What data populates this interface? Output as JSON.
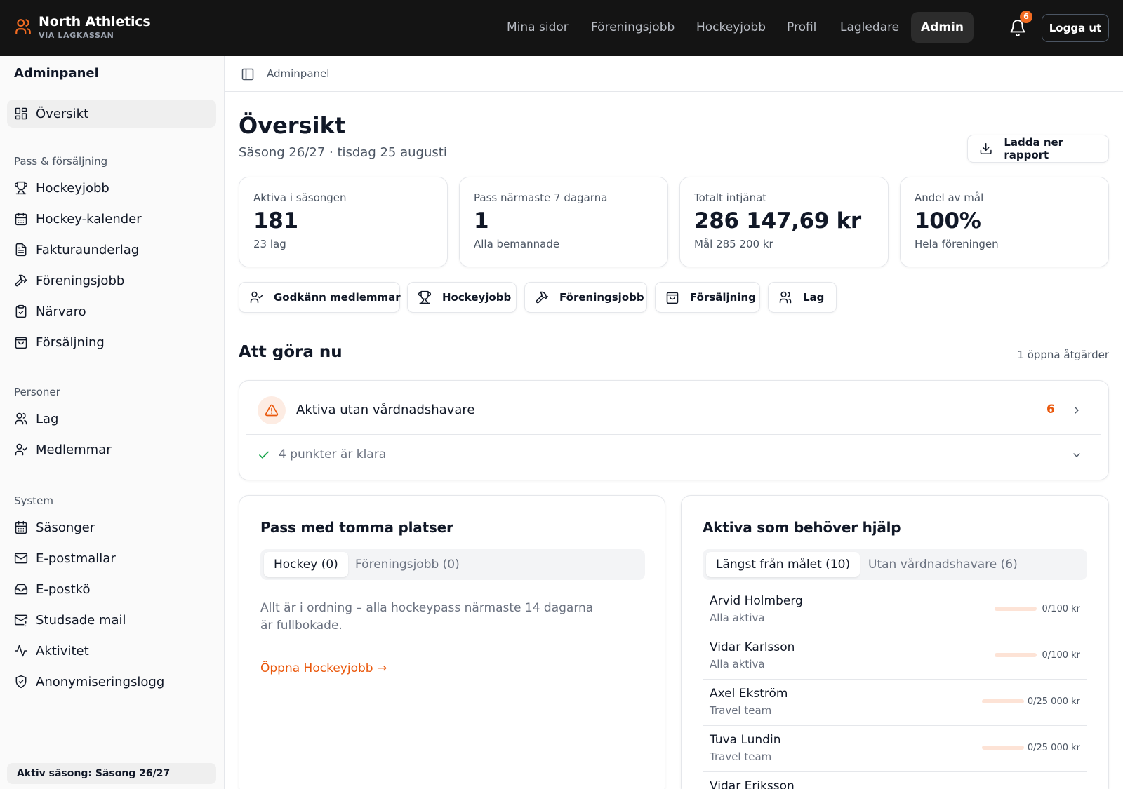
{
  "brand": {
    "name": "North Athletics",
    "sub": "VIA LAGKASSAN"
  },
  "nav": [
    {
      "label": "Mina sidor"
    },
    {
      "label": "Föreningsjobb"
    },
    {
      "label": "Hockeyjobb"
    },
    {
      "label": "Profil"
    },
    {
      "label": "Lagledare"
    },
    {
      "label": "Admin",
      "active": true
    }
  ],
  "notifications": {
    "count": "6",
    "icon": "bell-icon"
  },
  "logout_label": "Logga ut",
  "sidebar": {
    "title": "Adminpanel",
    "overview": "Översikt",
    "sections": {
      "pass": "Pass & försäljning",
      "persons": "Personer",
      "system": "System"
    },
    "pass_items": [
      "Hockeyjobb",
      "Hockey-kalender",
      "Fakturaunderlag",
      "Föreningsjobb",
      "Närvaro",
      "Försäljning"
    ],
    "person_items": [
      "Lag",
      "Medlemmar"
    ],
    "system_items": [
      "Säsonger",
      "E-postmallar",
      "E-postkö",
      "Studsade mail",
      "Aktivitet",
      "Anonymiseringslogg"
    ],
    "footer": "Aktiv säsong: Säsong 26/27"
  },
  "breadcrumb": "Adminpanel",
  "page": {
    "title": "Översikt",
    "subtitle": "Säsong 26/27 · tisdag 25 augusti",
    "report_button": "Ladda ner rapport"
  },
  "kpis": [
    {
      "label": "Aktiva i säsongen",
      "value": "181",
      "sub": "23 lag"
    },
    {
      "label": "Pass närmaste 7 dagarna",
      "value": "1",
      "sub": "Alla bemannade"
    },
    {
      "label": "Totalt intjänat",
      "value": "286 147,69 kr",
      "sub": "Mål 285 200 kr"
    },
    {
      "label": "Andel av mål",
      "value": "100%",
      "sub": "Hela föreningen"
    }
  ],
  "quick_actions": [
    "Godkänn medlemmar",
    "Hockeyjobb",
    "Föreningsjobb",
    "Försäljning",
    "Lag"
  ],
  "todo": {
    "title": "Att göra nu",
    "note": "1 öppna åtgärder",
    "item_title": "Aktiva utan vårdnadshavare",
    "item_count": "6",
    "done_text": "4 punkter är klara"
  },
  "empty_slots": {
    "title": "Pass med tomma platser",
    "tabs": [
      "Hockey (0)",
      "Föreningsjobb (0)"
    ],
    "message": "Allt är i ordning – alla hockeypass närmaste 14 dagarna är fullbokade.",
    "link": "Öppna Hockeyjobb →"
  },
  "help": {
    "title": "Aktiva som behöver hjälp",
    "tabs": [
      "Längst från målet (10)",
      "Utan vårdnadshavare (6)"
    ],
    "rows": [
      {
        "name": "Arvid Holmberg",
        "team": "Alla aktiva",
        "amount": "0/100 kr",
        "progress": 0
      },
      {
        "name": "Vidar Karlsson",
        "team": "Alla aktiva",
        "amount": "0/100 kr",
        "progress": 0
      },
      {
        "name": "Axel Ekström",
        "team": "Travel team",
        "amount": "0/25 000 kr",
        "progress": 0
      },
      {
        "name": "Tuva Lundin",
        "team": "Travel team",
        "amount": "0/25 000 kr",
        "progress": 0
      },
      {
        "name": "Vidar Eriksson",
        "team": "",
        "amount": "",
        "progress": 0
      }
    ]
  },
  "colors": {
    "accent": "#f26b21",
    "topbar": "#141414",
    "link": "#ea580c"
  }
}
